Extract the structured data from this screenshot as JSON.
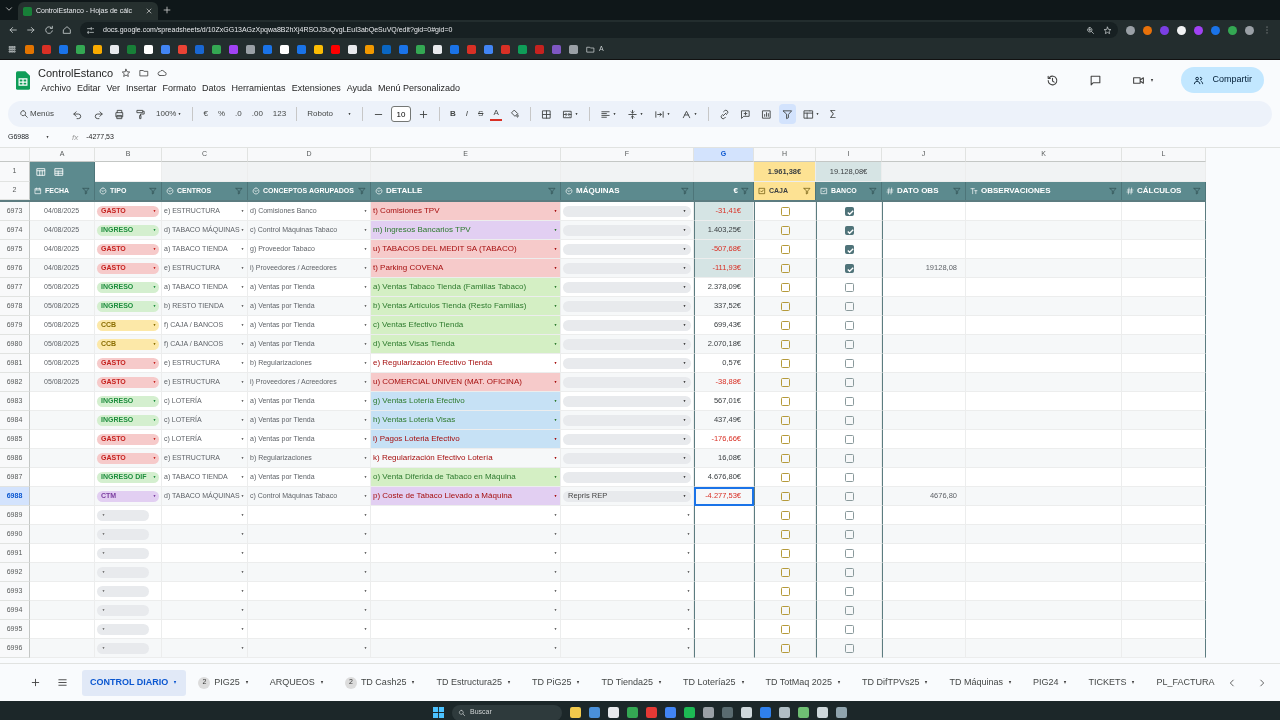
{
  "browser": {
    "tab_title": "ControlEstanco - Hojas de cálc",
    "url": "docs.google.com/spreadsheets/d/10ZxGG13AGzXpqwa8B2hXj4RSOJ3uQvgLEuI3abQeSuVQ/edit?gid=0#gid=0",
    "bookmark_folder": "A"
  },
  "document": {
    "title": "ControlEstanco",
    "share_button": "Compartir"
  },
  "menu": [
    "Archivo",
    "Editar",
    "Ver",
    "Insertar",
    "Formato",
    "Datos",
    "Herramientas",
    "Extensiones",
    "Ayuda",
    "Menú Personalizado"
  ],
  "toolbar": {
    "search": "Menús",
    "zoom": "100%",
    "currency": "€",
    "percent": "%",
    "decrease_decimals": ".0",
    "increase_decimals": ".00",
    "number_format": "123",
    "font": "Roboto",
    "font_size": "10",
    "bold": "B",
    "italic": "I",
    "strikethrough": "S",
    "text_color": "A",
    "sum": "Σ",
    "filter_on": true
  },
  "formula_bar": {
    "cell": "G6988",
    "fx": "fx",
    "formula": "-4277,53"
  },
  "column_letters": [
    {
      "label": "A",
      "selected": false
    },
    {
      "label": "B",
      "selected": false
    },
    {
      "label": "C",
      "selected": false
    },
    {
      "label": "D",
      "selected": false
    },
    {
      "label": "E",
      "selected": false
    },
    {
      "label": "F",
      "selected": false
    },
    {
      "label": "G",
      "selected": true
    },
    {
      "label": "H",
      "selected": false
    },
    {
      "label": "I",
      "selected": false
    },
    {
      "label": "J",
      "selected": false
    },
    {
      "label": "K",
      "selected": false
    },
    {
      "label": "L",
      "selected": false
    }
  ],
  "header": {
    "row_numbers": [
      "1",
      "2"
    ],
    "caja_total": "1.961,38€",
    "banco_total": "19.128,08€",
    "columns": [
      {
        "label": "FECHA",
        "kind": "calendar"
      },
      {
        "label": "TIPO",
        "kind": "dropdown"
      },
      {
        "label": "CENTROS",
        "kind": "dropdown"
      },
      {
        "label": "CONCEPTOS AGRUPADOS",
        "kind": "dropdown"
      },
      {
        "label": "DETALLE",
        "kind": "dropdown"
      },
      {
        "label": "MÁQUINAS",
        "kind": "dropdown"
      },
      {
        "label": "€",
        "kind": "plain"
      },
      {
        "label": "CAJA",
        "kind": "checkbox",
        "color": "#fde293"
      },
      {
        "label": "BANCO",
        "kind": "checkbox"
      },
      {
        "label": "DATO OBS",
        "kind": "number"
      },
      {
        "label": "OBSERVACIONES",
        "kind": "text"
      },
      {
        "label": "CÁLCULOS",
        "kind": "number"
      }
    ]
  },
  "rows": [
    {
      "number": "6973",
      "fecha": "04/08/2025",
      "tipo": {
        "label": "GASTO",
        "kind": "gasto",
        "color": "#f6caca"
      },
      "centro": "e) ESTRUCTURA",
      "concepto": "d) Comisiones Banco",
      "detalle": {
        "text": "t) Comisiones TPV",
        "color": "#f6caca"
      },
      "importe": "-31,41€",
      "negative": true,
      "highlighted": true,
      "caja": false,
      "banco": true,
      "selected": false
    },
    {
      "number": "6974",
      "fecha": "04/08/2025",
      "tipo": {
        "label": "INGRESO",
        "kind": "ingreso",
        "color": "#d4efcf"
      },
      "centro": "d) TABACO MÁQUINAS",
      "concepto": "c) Control Máquinas Tabaco",
      "detalle": {
        "text": "m) Ingresos Bancarios TPV",
        "color": "#e2cff2"
      },
      "importe": "1.403,25€",
      "negative": false,
      "highlighted": true,
      "caja": false,
      "banco": true,
      "selected": false
    },
    {
      "number": "6975",
      "fecha": "04/08/2025",
      "tipo": {
        "label": "GASTO",
        "kind": "gasto",
        "color": "#f6caca"
      },
      "centro": "a) TABACO TIENDA",
      "concepto": "g) Proveedor Tabaco",
      "detalle": {
        "text": "u) TABACOS DEL MEDIT SA (TABACO)",
        "color": "#f6caca"
      },
      "importe": "-507,68€",
      "negative": true,
      "highlighted": true,
      "caja": false,
      "banco": true,
      "selected": false
    },
    {
      "number": "6976",
      "fecha": "04/08/2025",
      "tipo": {
        "label": "GASTO",
        "kind": "gasto",
        "color": "#f6caca"
      },
      "centro": "e) ESTRUCTURA",
      "concepto": "i) Proveedores / Acreedores",
      "detalle": {
        "text": "t) Parking COVENA",
        "color": "#f6caca"
      },
      "importe": "-111,93€",
      "negative": true,
      "highlighted": true,
      "caja": false,
      "banco": true,
      "dato_obs": "19128,08",
      "selected": false
    },
    {
      "number": "6977",
      "fecha": "05/08/2025",
      "tipo": {
        "label": "INGRESO",
        "kind": "ingreso",
        "color": "#d4efcf"
      },
      "centro": "a) TABACO TIENDA",
      "concepto": "a) Ventas por Tienda",
      "detalle": {
        "text": "a) Ventas Tabaco Tienda (Familias Tabaco)",
        "color": "#d4efc4"
      },
      "importe": "2.378,09€",
      "negative": false,
      "highlighted": false,
      "caja": false,
      "banco": false,
      "selected": false
    },
    {
      "number": "6978",
      "fecha": "05/08/2025",
      "tipo": {
        "label": "INGRESO",
        "kind": "ingreso",
        "color": "#d4efcf"
      },
      "centro": "b) RESTO TIENDA",
      "concepto": "a) Ventas por Tienda",
      "detalle": {
        "text": "b) Ventas Artículos Tienda (Resto Familias)",
        "color": "#d4efc4"
      },
      "importe": "337,52€",
      "negative": false,
      "highlighted": false,
      "caja": false,
      "banco": false,
      "selected": false
    },
    {
      "number": "6979",
      "fecha": "05/08/2025",
      "tipo": {
        "label": "CCB",
        "kind": "ccb",
        "color": "#fce8a8"
      },
      "centro": "f) CAJA / BANCOS",
      "concepto": "a) Ventas por Tienda",
      "detalle": {
        "text": "c) Ventas Efectivo Tienda",
        "color": "#d4efc4"
      },
      "importe": "699,43€",
      "negative": false,
      "highlighted": false,
      "caja": false,
      "banco": false,
      "selected": false
    },
    {
      "number": "6980",
      "fecha": "05/08/2025",
      "tipo": {
        "label": "CCB",
        "kind": "ccb",
        "color": "#fce8a8"
      },
      "centro": "f) CAJA / BANCOS",
      "concepto": "a) Ventas por Tienda",
      "detalle": {
        "text": "d) Ventas Visas Tienda",
        "color": "#d4efc4"
      },
      "importe": "2.070,18€",
      "negative": false,
      "highlighted": false,
      "caja": false,
      "banco": false,
      "selected": false
    },
    {
      "number": "6981",
      "fecha": "05/08/2025",
      "tipo": {
        "label": "GASTO",
        "kind": "gasto",
        "color": "#f6caca"
      },
      "centro": "e) ESTRUCTURA",
      "concepto": "b) Regularizaciones",
      "detalle": {
        "text": "e) Regularización Efectivo Tienda"
      },
      "importe": "0,57€",
      "negative": false,
      "highlighted": false,
      "caja": false,
      "banco": false,
      "selected": false
    },
    {
      "number": "6982",
      "fecha": "05/08/2025",
      "tipo": {
        "label": "GASTO",
        "kind": "gasto",
        "color": "#f6caca"
      },
      "centro": "e) ESTRUCTURA",
      "concepto": "i) Proveedores / Acreedores",
      "detalle": {
        "text": "u) COMERCIAL UNIVEN (MAT. OFICINA)",
        "color": "#f6caca"
      },
      "importe": "-38,88€",
      "negative": true,
      "highlighted": false,
      "caja": false,
      "banco": false,
      "selected": false
    },
    {
      "number": "6983",
      "tipo": {
        "label": "INGRESO",
        "kind": "ingreso",
        "color": "#d4efcf"
      },
      "centro": "c) LOTERÍA",
      "concepto": "a) Ventas por Tienda",
      "detalle": {
        "text": "g) Ventas Lotería Efectivo",
        "color": "#c6e1f5"
      },
      "importe": "567,01€",
      "negative": false,
      "highlighted": false,
      "caja": false,
      "banco": false,
      "selected": false
    },
    {
      "number": "6984",
      "tipo": {
        "label": "INGRESO",
        "kind": "ingreso",
        "color": "#d4efcf"
      },
      "centro": "c) LOTERÍA",
      "concepto": "a) Ventas por Tienda",
      "detalle": {
        "text": "h) Ventas Loteria Visas",
        "color": "#c6e1f5"
      },
      "importe": "437,49€",
      "negative": false,
      "highlighted": false,
      "caja": false,
      "banco": false,
      "selected": false
    },
    {
      "number": "6985",
      "tipo": {
        "label": "GASTO",
        "kind": "gasto",
        "color": "#f6caca"
      },
      "centro": "c) LOTERÍA",
      "concepto": "a) Ventas por Tienda",
      "detalle": {
        "text": "i) Pagos Loteria Efectivo",
        "color": "#c6e1f5"
      },
      "importe": "-176,66€",
      "negative": true,
      "highlighted": false,
      "caja": false,
      "banco": false,
      "selected": false
    },
    {
      "number": "6986",
      "tipo": {
        "label": "GASTO",
        "kind": "gasto",
        "color": "#f6caca"
      },
      "centro": "e) ESTRUCTURA",
      "concepto": "b) Regularizaciones",
      "detalle": {
        "text": "k) Regularización Efectivo Lotería"
      },
      "importe": "16,08€",
      "negative": false,
      "highlighted": false,
      "caja": false,
      "banco": false,
      "selected": false
    },
    {
      "number": "6987",
      "tipo": {
        "label": "INGRESO DIF",
        "kind": "ingreso",
        "color": "#d4efcf"
      },
      "centro": "a) TABACO TIENDA",
      "concepto": "a) Ventas por Tienda",
      "detalle": {
        "text": "o) Venta Diferida de Tabaco en Máquina",
        "color": "#d4efc4"
      },
      "importe": "4.676,80€",
      "negative": false,
      "highlighted": false,
      "caja": false,
      "banco": false,
      "selected": false
    },
    {
      "number": "6988",
      "tipo": {
        "label": "CTM",
        "kind": "ctm",
        "color": "#e2cff2"
      },
      "centro": "d) TABACO MÁQUINAS",
      "concepto": "c) Control Máquinas Tabaco",
      "detalle": {
        "text": "p) Coste de Tabaco Llevado a Máquina",
        "color": "#e2cff2"
      },
      "maquina": "Repris REP",
      "importe": "-4.277,53€",
      "negative": true,
      "highlighted": false,
      "caja": false,
      "banco": false,
      "dato_obs": "4676,80",
      "selected": true
    },
    {
      "number": "6989",
      "caja": false,
      "banco": false,
      "selected": false
    },
    {
      "number": "6990",
      "caja": false,
      "banco": false,
      "selected": false
    },
    {
      "number": "6991",
      "caja": false,
      "banco": false,
      "selected": false
    },
    {
      "number": "6992",
      "caja": false,
      "banco": false,
      "selected": false
    },
    {
      "number": "6993",
      "caja": false,
      "banco": false,
      "selected": false
    },
    {
      "number": "6994",
      "caja": false,
      "banco": false,
      "selected": false
    },
    {
      "number": "6995",
      "caja": false,
      "banco": false,
      "selected": false
    },
    {
      "number": "6996",
      "caja": false,
      "banco": false,
      "selected": false
    }
  ],
  "sheet_tabs": [
    {
      "label": "CONTROL DIARIO",
      "selected": true
    },
    {
      "label": "PIG25",
      "badge": "2",
      "selected": false
    },
    {
      "label": "ARQUEOS",
      "selected": false
    },
    {
      "label": "TD Cash25",
      "badge": "2",
      "selected": false
    },
    {
      "label": "TD Estructura25",
      "selected": false
    },
    {
      "label": "TD PiG25",
      "selected": false
    },
    {
      "label": "TD Tienda25",
      "selected": false
    },
    {
      "label": "TD Lotería25",
      "selected": false
    },
    {
      "label": "TD TotMaq 2025",
      "selected": false
    },
    {
      "label": "TD DifTPVs25",
      "selected": false
    },
    {
      "label": "TD Máquinas",
      "selected": false
    },
    {
      "label": "PIG24",
      "selected": false
    },
    {
      "label": "TICKETS",
      "selected": false
    },
    {
      "label": "PL_FACTURA",
      "selected": false
    }
  ],
  "taskbar": {
    "search": "Buscar"
  }
}
